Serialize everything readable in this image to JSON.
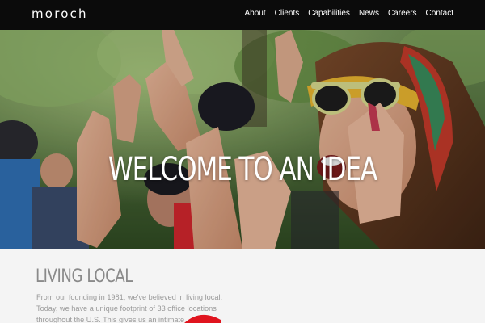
{
  "header": {
    "logo": "moroch",
    "nav": [
      {
        "label": "About"
      },
      {
        "label": "Clients"
      },
      {
        "label": "Capabilities"
      },
      {
        "label": "News"
      },
      {
        "label": "Careers"
      },
      {
        "label": "Contact"
      }
    ]
  },
  "hero": {
    "title": "WELCOME TO AN IDEA"
  },
  "section": {
    "heading": "LIVING LOCAL",
    "body": "From our founding in 1981, we've believed in living local. Today, we have a unique footprint of 33 office locations throughout the U.S. This gives us an intimate"
  },
  "colors": {
    "nav_bg": "#0b0b0b",
    "content_bg": "#f4f4f4",
    "heading": "#8a8a8a",
    "accent_red": "#e0141e"
  }
}
